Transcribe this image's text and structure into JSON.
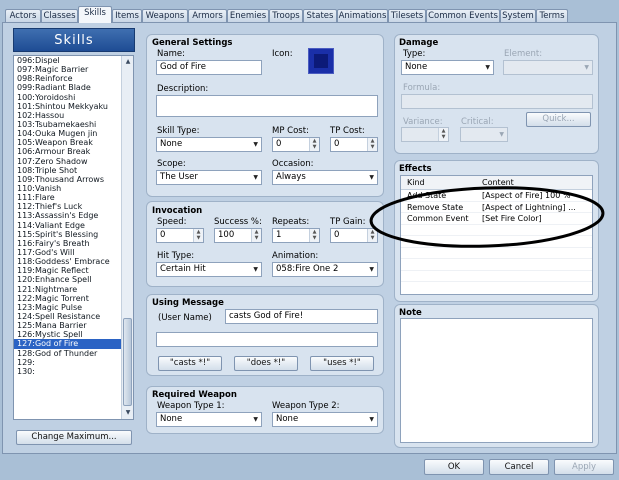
{
  "tabs": [
    "Actors",
    "Classes",
    "Skills",
    "Items",
    "Weapons",
    "Armors",
    "Enemies",
    "Troops",
    "States",
    "Animations",
    "Tilesets",
    "Common Events",
    "System",
    "Terms"
  ],
  "active_tab": "Skills",
  "list_title": "Skills",
  "skills": [
    "096:Dispel",
    "097:Magic Barrier",
    "098:Reinforce",
    "099:Radiant Blade",
    "100:Yoroidoshi",
    "101:Shintou Mekkyaku",
    "102:Hassou",
    "103:Tsubamekaeshi",
    "104:Ouka Mugen jin",
    "105:Weapon Break",
    "106:Armour Break",
    "107:Zero Shadow",
    "108:Triple Shot",
    "109:Thousand Arrows",
    "110:Vanish",
    "111:Flare",
    "112:Thief's Luck",
    "113:Assassin's Edge",
    "114:Valiant Edge",
    "115:Spirit's Blessing",
    "116:Fairy's Breath",
    "117:God's Will",
    "118:Goddess' Embrace",
    "119:Magic Reflect",
    "120:Enhance Spell",
    "121:Nightmare",
    "122:Magic Torrent",
    "123:Magic Pulse",
    "124:Spell Resistance",
    "125:Mana Barrier",
    "126:Mystic Spell",
    "127:God of Fire",
    "128:God of Thunder",
    "129:",
    "130:"
  ],
  "selected_skill": "127:God of Fire",
  "change_max_label": "Change Maximum...",
  "general": {
    "title": "General Settings",
    "name_label": "Name:",
    "name_value": "God of Fire",
    "icon_label": "Icon:",
    "desc_label": "Description:",
    "desc_value": "",
    "skill_type_label": "Skill Type:",
    "skill_type_value": "None",
    "mp_label": "MP Cost:",
    "mp_value": "0",
    "tp_label": "TP Cost:",
    "tp_value": "0",
    "scope_label": "Scope:",
    "scope_value": "The User",
    "occasion_label": "Occasion:",
    "occasion_value": "Always"
  },
  "invocation": {
    "title": "Invocation",
    "speed_label": "Speed:",
    "speed_value": "0",
    "success_label": "Success %:",
    "success_value": "100",
    "repeats_label": "Repeats:",
    "repeats_value": "1",
    "tpgain_label": "TP Gain:",
    "tpgain_value": "0",
    "hittype_label": "Hit Type:",
    "hittype_value": "Certain Hit",
    "animation_label": "Animation:",
    "animation_value": "058:Fire One 2"
  },
  "message": {
    "title": "Using Message",
    "user_label": "(User Name)",
    "line1": "casts God of Fire!",
    "line2": "",
    "btn1": "\"casts *!\"",
    "btn2": "\"does *!\"",
    "btn3": "\"uses *!\""
  },
  "weapon": {
    "title": "Required Weapon",
    "type1_label": "Weapon Type 1:",
    "type1_value": "None",
    "type2_label": "Weapon Type 2:",
    "type2_value": "None"
  },
  "damage": {
    "title": "Damage",
    "type_label": "Type:",
    "type_value": "None",
    "element_label": "Element:",
    "element_value": "",
    "formula_label": "Formula:",
    "formula_value": "",
    "variance_label": "Variance:",
    "variance_value": "",
    "critical_label": "Critical:",
    "critical_value": "",
    "quick_label": "Quick..."
  },
  "effects": {
    "title": "Effects",
    "col_kind": "Kind",
    "col_content": "Content",
    "rows": [
      {
        "kind": "Add State",
        "content": "[Aspect of Fire] 100 %"
      },
      {
        "kind": "Remove State",
        "content": "[Aspect of Lightning] ..."
      },
      {
        "kind": "Common Event",
        "content": "[Set Fire Color]"
      }
    ]
  },
  "note": {
    "title": "Note",
    "value": ""
  },
  "footer": {
    "ok": "OK",
    "cancel": "Cancel",
    "apply": "Apply"
  }
}
